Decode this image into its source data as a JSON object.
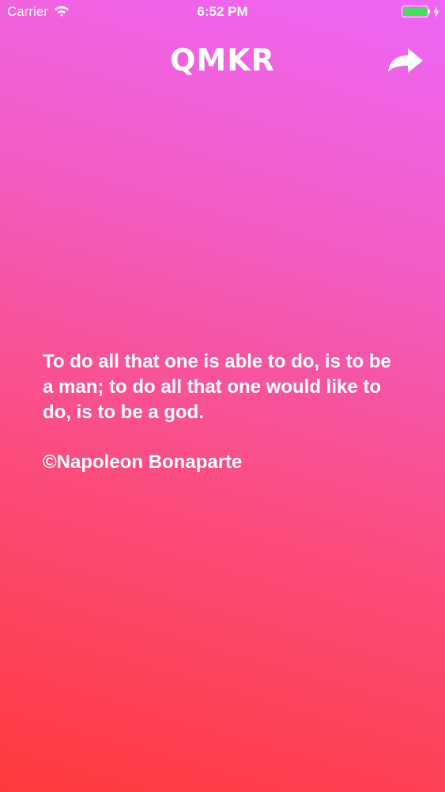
{
  "status_bar": {
    "carrier": "Carrier",
    "time": "6:52 PM",
    "battery_color": "#4cd964"
  },
  "nav": {
    "logo": "QMKR",
    "share_icon": "share-arrow-icon"
  },
  "quote": {
    "text": "To do all that one is able to do, is to be a man; to do all that one would like to do, is to be a god.",
    "author": "©Napoleon Bonaparte"
  },
  "colors": {
    "gradient_top": "#ee66f6",
    "gradient_bottom": "#ff3a3c",
    "text": "#ffffff"
  }
}
